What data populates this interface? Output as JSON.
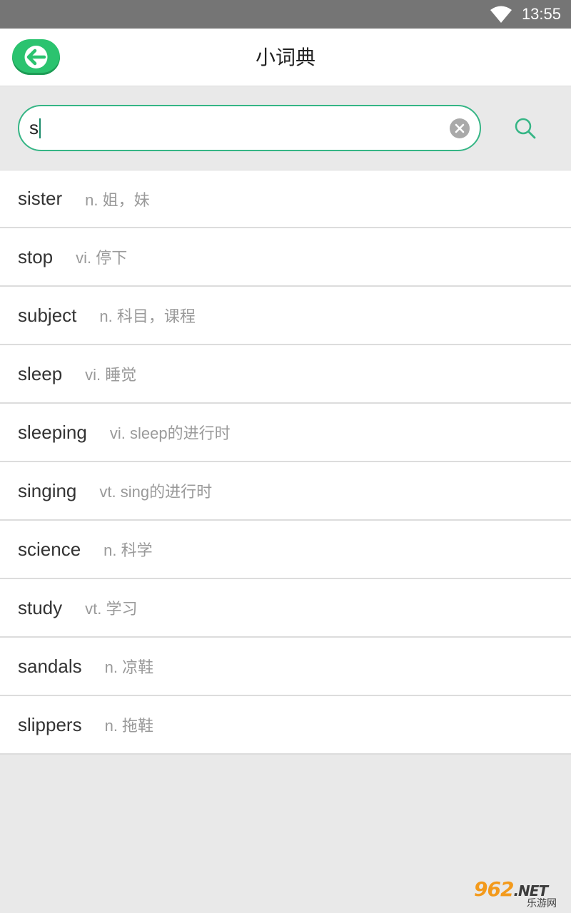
{
  "status_bar": {
    "time": "13:55",
    "wifi_icon": "wifi-icon"
  },
  "header": {
    "title": "小词典",
    "back_icon": "arrow-left-icon",
    "accent_color": "#2bc36f"
  },
  "search": {
    "value": "s",
    "clear_icon": "clear-icon",
    "search_icon": "search-icon",
    "border_color": "#35b585"
  },
  "words": [
    {
      "word": "sister",
      "definition": "n. 姐，妹"
    },
    {
      "word": "stop",
      "definition": "vi. 停下"
    },
    {
      "word": "subject",
      "definition": "n. 科目，课程"
    },
    {
      "word": "sleep",
      "definition": "vi. 睡觉"
    },
    {
      "word": "sleeping",
      "definition": "vi. sleep的进行时"
    },
    {
      "word": "singing",
      "definition": "vt. sing的进行时"
    },
    {
      "word": "science",
      "definition": "n. 科学"
    },
    {
      "word": "study",
      "definition": "vt. 学习"
    },
    {
      "word": "sandals",
      "definition": "n. 凉鞋"
    },
    {
      "word": "slippers",
      "definition": "n. 拖鞋"
    }
  ],
  "watermark": {
    "brand": "962",
    "suffix": ".NET",
    "subtitle": "乐游网"
  }
}
